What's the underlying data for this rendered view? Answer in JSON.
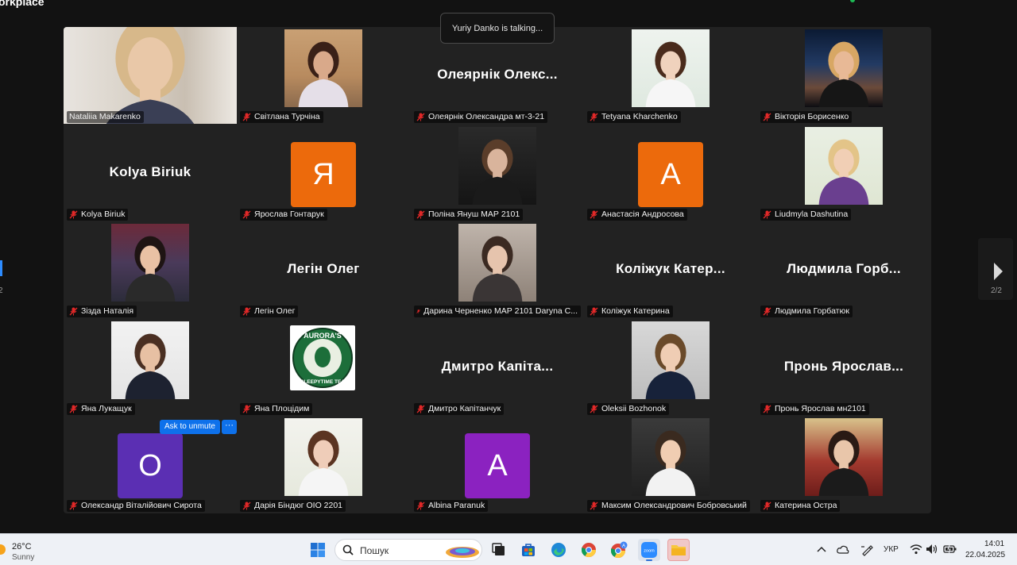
{
  "app": {
    "title": "orkplace"
  },
  "talking_banner": "Yuriy Danko is talking...",
  "participants": [
    {
      "name": "Nataliia Makarenko",
      "big": "",
      "avatar_letter": "",
      "avatar_color": "",
      "muted": false,
      "type": "video"
    },
    {
      "name": "Світлана Турчіна",
      "big": "",
      "avatar_letter": "",
      "avatar_color": "",
      "muted": true,
      "type": "video"
    },
    {
      "name": "Олеярнік Олександра мт-3-21",
      "big": "Олеярнік Олекс...",
      "avatar_letter": "",
      "avatar_color": "",
      "muted": true,
      "type": "text"
    },
    {
      "name": "Tetyana Kharchenko",
      "big": "",
      "avatar_letter": "",
      "avatar_color": "",
      "muted": true,
      "type": "photo"
    },
    {
      "name": "Вікторія Борисенко",
      "big": "",
      "avatar_letter": "",
      "avatar_color": "",
      "muted": true,
      "type": "photo"
    },
    {
      "name": "Kolya Biriuk",
      "big": "Kolya Biriuk",
      "avatar_letter": "",
      "avatar_color": "",
      "muted": true,
      "type": "text"
    },
    {
      "name": "Ярослав Гонтарук",
      "big": "",
      "avatar_letter": "Я",
      "avatar_color": "#ec6a0c",
      "muted": true,
      "type": "letter"
    },
    {
      "name": "Поліна Януш МАР 2101",
      "big": "",
      "avatar_letter": "",
      "avatar_color": "",
      "muted": true,
      "type": "photo"
    },
    {
      "name": "Анастасія Андросова",
      "big": "",
      "avatar_letter": "А",
      "avatar_color": "#ec6a0c",
      "muted": true,
      "type": "letter"
    },
    {
      "name": "Liudmyla Dashutina",
      "big": "",
      "avatar_letter": "",
      "avatar_color": "",
      "muted": true,
      "type": "photo"
    },
    {
      "name": "Зізда Наталія",
      "big": "",
      "avatar_letter": "",
      "avatar_color": "",
      "muted": true,
      "type": "photo"
    },
    {
      "name": "Легін Олег",
      "big": "Легін Олег",
      "avatar_letter": "",
      "avatar_color": "",
      "muted": true,
      "type": "text"
    },
    {
      "name": "Дарина Черненко МАР 2101 Daryna C...",
      "big": "",
      "avatar_letter": "",
      "avatar_color": "",
      "muted": true,
      "type": "photo"
    },
    {
      "name": "Коліжук Катерина",
      "big": "Коліжук Катер...",
      "avatar_letter": "",
      "avatar_color": "",
      "muted": true,
      "type": "text"
    },
    {
      "name": "Людмила Горбатюк",
      "big": "Людмила Горб...",
      "avatar_letter": "",
      "avatar_color": "",
      "muted": true,
      "type": "text"
    },
    {
      "name": "Яна Лукащук",
      "big": "",
      "avatar_letter": "",
      "avatar_color": "",
      "muted": true,
      "type": "photo"
    },
    {
      "name": "Яна Плоцідим",
      "big": "",
      "avatar_letter": "",
      "avatar_color": "",
      "muted": true,
      "type": "logo"
    },
    {
      "name": "Дмитро Капітанчук",
      "big": "Дмитро Капіта...",
      "avatar_letter": "",
      "avatar_color": "",
      "muted": true,
      "type": "text"
    },
    {
      "name": "Oleksii Bozhonok",
      "big": "",
      "avatar_letter": "",
      "avatar_color": "",
      "muted": true,
      "type": "photo"
    },
    {
      "name": "Пронь Ярослав мн2101",
      "big": "Пронь Ярослав...",
      "avatar_letter": "",
      "avatar_color": "",
      "muted": true,
      "type": "text"
    },
    {
      "name": "Олександр Віталійович Сирота",
      "big": "",
      "avatar_letter": "О",
      "avatar_color": "#5b2fb3",
      "muted": true,
      "type": "letter"
    },
    {
      "name": "Дарія Біндюг ОІО 2201",
      "big": "",
      "avatar_letter": "",
      "avatar_color": "",
      "muted": true,
      "type": "photo"
    },
    {
      "name": "Albina Paranuk",
      "big": "",
      "avatar_letter": "A",
      "avatar_color": "#8b22c0",
      "muted": true,
      "type": "letter"
    },
    {
      "name": "Максим Олександрович Бобровський",
      "big": "",
      "avatar_letter": "",
      "avatar_color": "",
      "muted": true,
      "type": "photo"
    },
    {
      "name": "Катерина Остра",
      "big": "",
      "avatar_letter": "",
      "avatar_color": "",
      "muted": true,
      "type": "photo"
    }
  ],
  "logo_text": {
    "top": "AURORA'S",
    "bottom": "SLEEPYTIME TEA"
  },
  "hover": {
    "ask_label": "Ask to unmute",
    "more_label": "···"
  },
  "pagination": {
    "left": "2",
    "right": "2/2"
  },
  "taskbar": {
    "temp": "26°C",
    "condition": "Sunny",
    "search_placeholder": "Пошук",
    "lang": "УКР",
    "time": "14:01",
    "date": "22.04.2025"
  },
  "colors": {
    "accent": "#0e71eb",
    "mute_red": "#e02828",
    "tile_bg": "#222222"
  }
}
